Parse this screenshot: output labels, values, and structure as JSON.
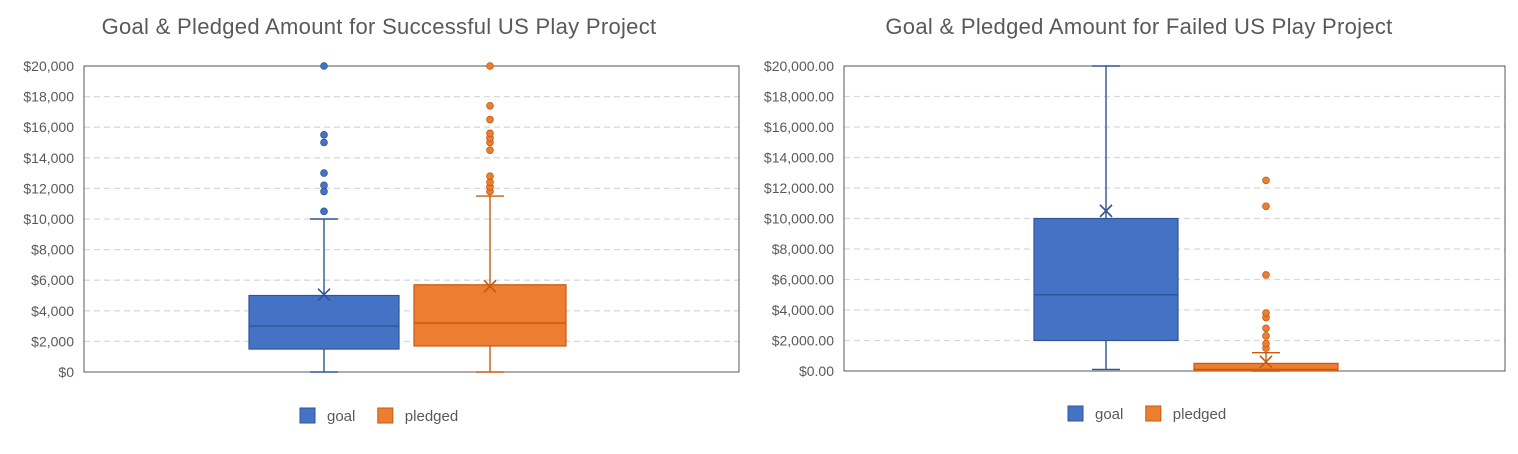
{
  "chart_data": [
    {
      "type": "box",
      "title": "Goal & Pledged Amount for Successful US Play Project",
      "xlabel": "",
      "ylabel": "",
      "ylim": [
        0,
        20000
      ],
      "yticks": [
        0,
        2000,
        4000,
        6000,
        8000,
        10000,
        12000,
        14000,
        16000,
        18000,
        20000
      ],
      "ytick_labels": [
        "$0",
        "$2,000",
        "$4,000",
        "$6,000",
        "$8,000",
        "$10,000",
        "$12,000",
        "$14,000",
        "$16,000",
        "$18,000",
        "$20,000"
      ],
      "grid": true,
      "legend_position": "bottom",
      "series": [
        {
          "name": "goal",
          "color": "#4472C4",
          "min": 0,
          "q1": 1500,
          "median": 3000,
          "q3": 5000,
          "max": 10000,
          "mean": 5050,
          "outliers": [
            10500,
            11800,
            12200,
            13000,
            15000,
            15500,
            20000
          ]
        },
        {
          "name": "pledged",
          "color": "#ED7D31",
          "min": 0,
          "q1": 1700,
          "median": 3200,
          "q3": 5700,
          "max": 11500,
          "mean": 5600,
          "outliers": [
            11800,
            12100,
            12400,
            12800,
            14500,
            15000,
            15300,
            15600,
            16500,
            17400,
            20000
          ]
        }
      ]
    },
    {
      "type": "box",
      "title": "Goal & Pledged Amount for Failed US Play Project",
      "xlabel": "",
      "ylabel": "",
      "ylim": [
        0,
        20000
      ],
      "yticks": [
        0,
        2000,
        4000,
        6000,
        8000,
        10000,
        12000,
        14000,
        16000,
        18000,
        20000
      ],
      "ytick_labels": [
        "$0.00",
        "$2,000.00",
        "$4,000.00",
        "$6,000.00",
        "$8,000.00",
        "$10,000.00",
        "$12,000.00",
        "$14,000.00",
        "$16,000.00",
        "$18,000.00",
        "$20,000.00"
      ],
      "grid": true,
      "legend_position": "bottom",
      "series": [
        {
          "name": "goal",
          "color": "#4472C4",
          "min": 100,
          "q1": 2000,
          "median": 5000,
          "q3": 10000,
          "max": 20000,
          "mean": 10500,
          "outliers": []
        },
        {
          "name": "pledged",
          "color": "#ED7D31",
          "min": 0,
          "q1": 0,
          "median": 100,
          "q3": 500,
          "max": 1200,
          "mean": 600,
          "outliers": [
            1500,
            1800,
            2300,
            2800,
            3500,
            3800,
            6300,
            10800,
            12500
          ]
        }
      ]
    }
  ]
}
